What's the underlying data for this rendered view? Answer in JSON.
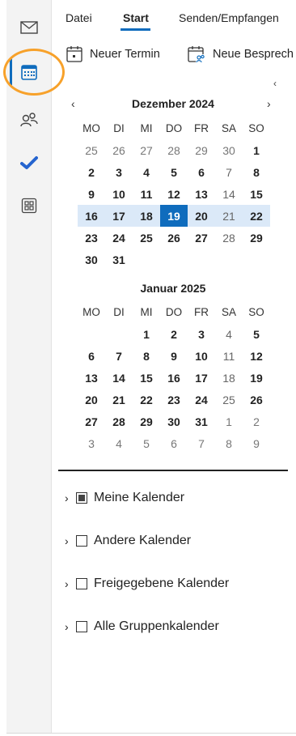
{
  "rail": {
    "items": [
      {
        "name": "mail-icon"
      },
      {
        "name": "calendar-icon"
      },
      {
        "name": "people-icon"
      },
      {
        "name": "todo-icon"
      },
      {
        "name": "apps-icon"
      }
    ],
    "accent": "#0f6cbd",
    "highlight": "#f7a12a"
  },
  "tabs": {
    "file": "Datei",
    "start": "Start",
    "send_receive": "Senden/Empfangen"
  },
  "commands": {
    "new_appointment": "Neuer Termin",
    "new_meeting": "Neue Besprech"
  },
  "december": {
    "title": "Dezember 2024",
    "weekdays": [
      "MO",
      "DI",
      "MI",
      "DO",
      "FR",
      "SA",
      "SO"
    ],
    "weeks": [
      [
        "25",
        "26",
        "27",
        "28",
        "29",
        "30",
        "1"
      ],
      [
        "2",
        "3",
        "4",
        "5",
        "6",
        "7",
        "8"
      ],
      [
        "9",
        "10",
        "11",
        "12",
        "13",
        "14",
        "15"
      ],
      [
        "16",
        "17",
        "18",
        "19",
        "20",
        "21",
        "22"
      ],
      [
        "23",
        "24",
        "25",
        "26",
        "27",
        "28",
        "29"
      ],
      [
        "30",
        "31",
        "",
        "",
        "",
        "",
        ""
      ]
    ],
    "today": "19"
  },
  "january": {
    "title": "Januar 2025",
    "weekdays": [
      "MO",
      "DI",
      "MI",
      "DO",
      "FR",
      "SA",
      "SO"
    ],
    "weeks": [
      [
        "",
        "",
        "1",
        "2",
        "3",
        "4",
        "5"
      ],
      [
        "6",
        "7",
        "8",
        "9",
        "10",
        "11",
        "12"
      ],
      [
        "13",
        "14",
        "15",
        "16",
        "17",
        "18",
        "19"
      ],
      [
        "20",
        "21",
        "22",
        "23",
        "24",
        "25",
        "26"
      ],
      [
        "27",
        "28",
        "29",
        "30",
        "31",
        "1",
        "2"
      ],
      [
        "3",
        "4",
        "5",
        "6",
        "7",
        "8",
        "9"
      ]
    ]
  },
  "calendar_groups": [
    {
      "label": "Meine Kalender",
      "checked": true
    },
    {
      "label": "Andere Kalender",
      "checked": false
    },
    {
      "label": "Freigegebene Kalender",
      "checked": false
    },
    {
      "label": "Alle Gruppenkalender",
      "checked": false
    }
  ]
}
